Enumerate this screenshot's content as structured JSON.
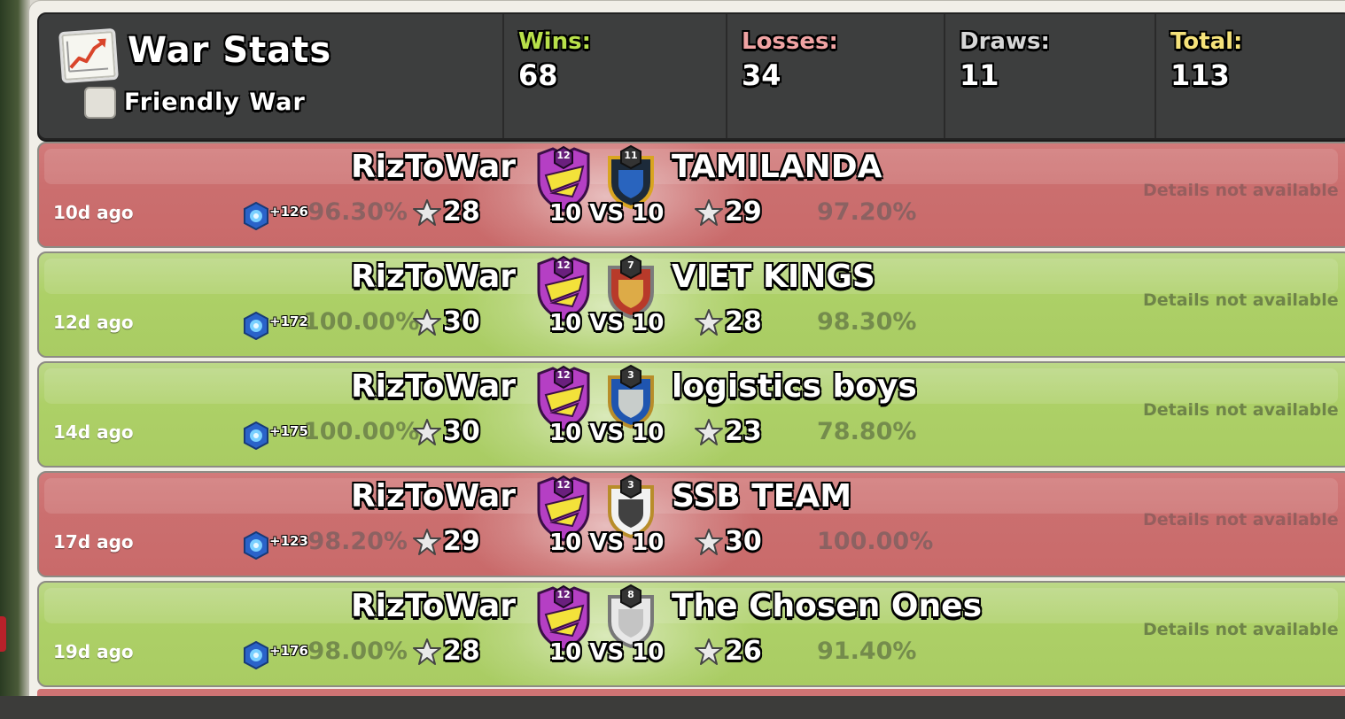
{
  "header": {
    "title": "War Stats",
    "friendly_war_label": "Friendly War",
    "friendly_war_checked": false,
    "stats": [
      {
        "label": "Wins:",
        "value": "68",
        "color": "#b8e04a"
      },
      {
        "label": "Losses:",
        "value": "34",
        "color": "#f0a3a3"
      },
      {
        "label": "Draws:",
        "value": "11",
        "color": "#d6d6d6"
      },
      {
        "label": "Total:",
        "value": "113",
        "color": "#f5e27a"
      }
    ]
  },
  "wars": [
    {
      "result": "loss",
      "ago": "10d ago",
      "clan": "RizToWar",
      "clan_level": "12",
      "xp": "+126",
      "own_pct": "96.30%",
      "own_stars": "28",
      "vs": "10 VS 10",
      "opponent": "TAMILANDA",
      "opp_level": "11",
      "opp_stars": "29",
      "opp_pct": "97.20%",
      "details": "Details not available"
    },
    {
      "result": "win",
      "ago": "12d ago",
      "clan": "RizToWar",
      "clan_level": "12",
      "xp": "+172",
      "own_pct": "100.00%",
      "own_stars": "30",
      "vs": "10 VS 10",
      "opponent": "VIET KINGS",
      "opp_level": "7",
      "opp_stars": "28",
      "opp_pct": "98.30%",
      "details": "Details not available"
    },
    {
      "result": "win",
      "ago": "14d ago",
      "clan": "RizToWar",
      "clan_level": "12",
      "xp": "+175",
      "own_pct": "100.00%",
      "own_stars": "30",
      "vs": "10 VS 10",
      "opponent": "logistics boys",
      "opp_level": "3",
      "opp_stars": "23",
      "opp_pct": "78.80%",
      "details": "Details not available"
    },
    {
      "result": "loss",
      "ago": "17d ago",
      "clan": "RizToWar",
      "clan_level": "12",
      "xp": "+123",
      "own_pct": "98.20%",
      "own_stars": "29",
      "vs": "10 VS 10",
      "opponent": "SSB TEAM",
      "opp_level": "3",
      "opp_stars": "30",
      "opp_pct": "100.00%",
      "details": "Details not available"
    },
    {
      "result": "win",
      "ago": "19d ago",
      "clan": "RizToWar",
      "clan_level": "12",
      "xp": "+176",
      "own_pct": "98.00%",
      "own_stars": "28",
      "vs": "10 VS 10",
      "opponent": "The Chosen Ones",
      "opp_level": "8",
      "opp_stars": "26",
      "opp_pct": "91.40%",
      "details": "Details not available"
    }
  ]
}
